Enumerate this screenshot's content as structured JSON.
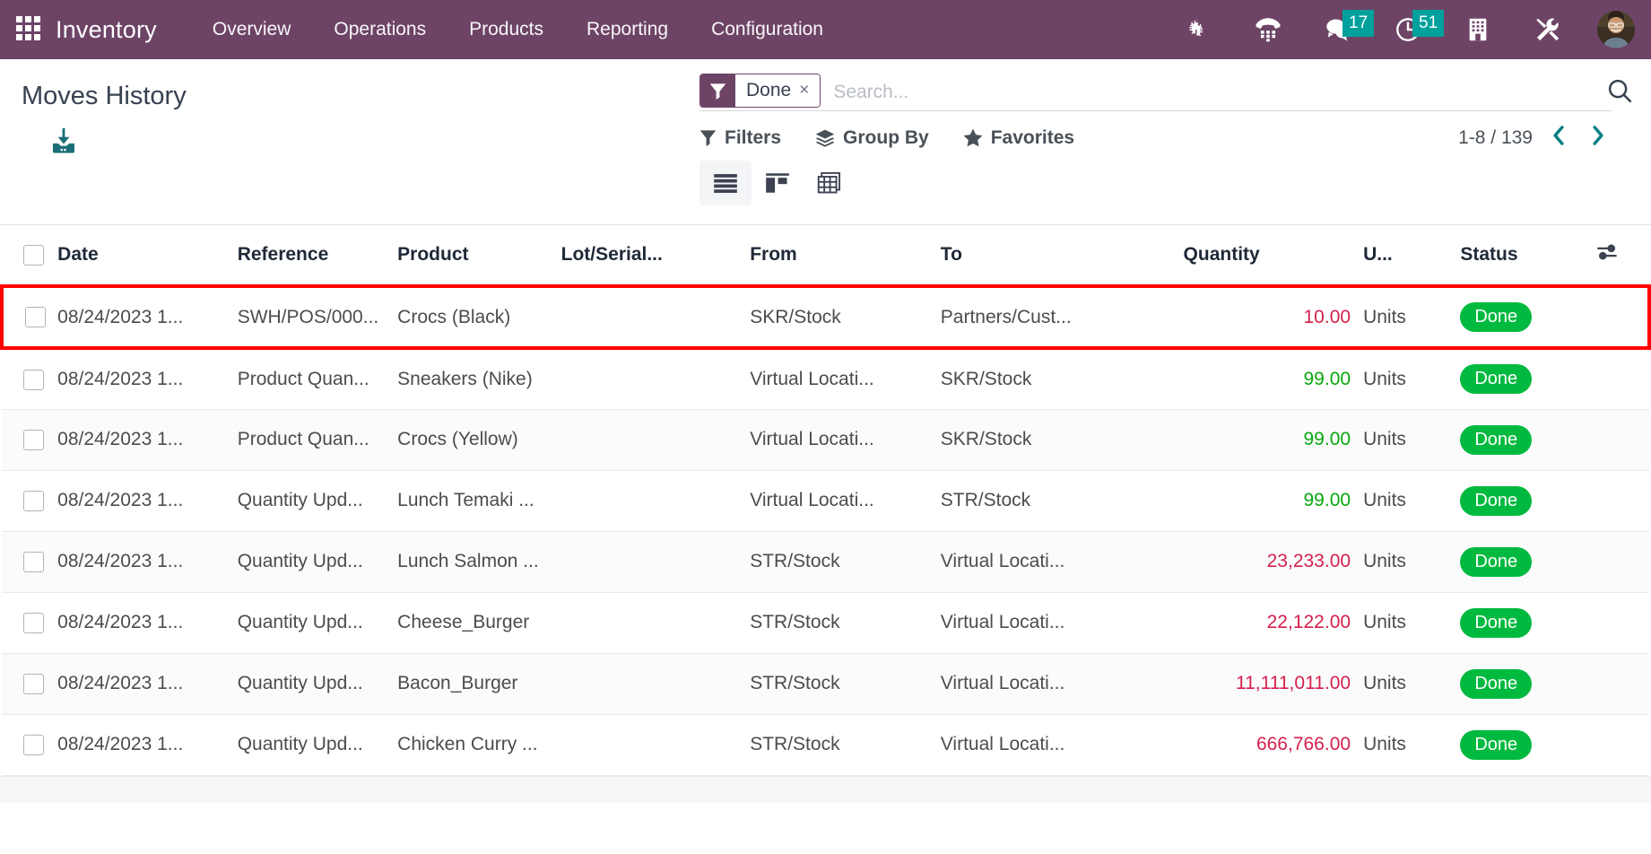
{
  "navbar": {
    "apps_icon": "apps-grid-icon",
    "brand": "Inventory",
    "menu": [
      {
        "label": "Overview"
      },
      {
        "label": "Operations"
      },
      {
        "label": "Products"
      },
      {
        "label": "Reporting"
      },
      {
        "label": "Configuration"
      }
    ],
    "sys_icons": [
      {
        "name": "bug-icon",
        "badge": null
      },
      {
        "name": "voip-dialpad-icon",
        "badge": null
      },
      {
        "name": "messages-icon",
        "badge": "17"
      },
      {
        "name": "activities-clock-icon",
        "badge": "51"
      },
      {
        "name": "company-building-icon",
        "badge": null
      },
      {
        "name": "debug-tools-icon",
        "badge": null
      }
    ],
    "avatar": "user-avatar",
    "badge_color": "#00a09d",
    "bg_color": "#6d4466"
  },
  "control_panel": {
    "title": "Moves History",
    "import_icon": "import-download-icon",
    "search": {
      "facet": {
        "icon": "filter-funnel-icon",
        "label": "Done",
        "remove": "×"
      },
      "placeholder": "Search...",
      "value": "",
      "magnifier_icon": "search-icon"
    },
    "buttons": [
      {
        "icon": "filter-funnel-icon",
        "label": "Filters",
        "name": "filters-dropdown"
      },
      {
        "icon": "group-by-layers-icon",
        "label": "Group By",
        "name": "group-by-dropdown"
      },
      {
        "icon": "star-icon",
        "label": "Favorites",
        "name": "favorites-dropdown"
      }
    ],
    "pager": {
      "count": "1-8 / 139",
      "prev": "‹",
      "next": "›"
    },
    "views": [
      {
        "name": "list-view-button",
        "icon": "list-icon",
        "active": true
      },
      {
        "name": "kanban-view-button",
        "icon": "kanban-icon",
        "active": false
      },
      {
        "name": "pivot-view-button",
        "icon": "pivot-grid-icon",
        "active": false
      }
    ]
  },
  "table": {
    "columns": [
      {
        "key": "date",
        "label": "Date"
      },
      {
        "key": "reference",
        "label": "Reference"
      },
      {
        "key": "product",
        "label": "Product"
      },
      {
        "key": "lot",
        "label": "Lot/Serial..."
      },
      {
        "key": "from",
        "label": "From"
      },
      {
        "key": "to",
        "label": "To"
      },
      {
        "key": "quantity",
        "label": "Quantity"
      },
      {
        "key": "uom",
        "label": "U..."
      },
      {
        "key": "status",
        "label": "Status"
      }
    ],
    "optional_columns_icon": "column-options-icon",
    "rows": [
      {
        "date": "08/24/2023 1...",
        "reference": "SWH/POS/000...",
        "product": "Crocs (Black)",
        "lot": "",
        "from": "SKR/Stock",
        "to": "Partners/Cust...",
        "quantity": "10.00",
        "quantity_sign": "neg",
        "uom": "Units",
        "status": "Done",
        "highlighted": true
      },
      {
        "date": "08/24/2023 1...",
        "reference": "Product Quan...",
        "product": "Sneakers (Nike)",
        "lot": "",
        "from": "Virtual Locati...",
        "to": "SKR/Stock",
        "quantity": "99.00",
        "quantity_sign": "pos",
        "uom": "Units",
        "status": "Done",
        "highlighted": false
      },
      {
        "date": "08/24/2023 1...",
        "reference": "Product Quan...",
        "product": "Crocs (Yellow)",
        "lot": "",
        "from": "Virtual Locati...",
        "to": "SKR/Stock",
        "quantity": "99.00",
        "quantity_sign": "pos",
        "uom": "Units",
        "status": "Done",
        "highlighted": false
      },
      {
        "date": "08/24/2023 1...",
        "reference": "Quantity Upd...",
        "product": "Lunch Temaki ...",
        "lot": "",
        "from": "Virtual Locati...",
        "to": "STR/Stock",
        "quantity": "99.00",
        "quantity_sign": "pos",
        "uom": "Units",
        "status": "Done",
        "highlighted": false
      },
      {
        "date": "08/24/2023 1...",
        "reference": "Quantity Upd...",
        "product": "Lunch Salmon ...",
        "lot": "",
        "from": "STR/Stock",
        "to": "Virtual Locati...",
        "quantity": "23,233.00",
        "quantity_sign": "neg",
        "uom": "Units",
        "status": "Done",
        "highlighted": false
      },
      {
        "date": "08/24/2023 1...",
        "reference": "Quantity Upd...",
        "product": "Cheese_Burger",
        "lot": "",
        "from": "STR/Stock",
        "to": "Virtual Locati...",
        "quantity": "22,122.00",
        "quantity_sign": "neg",
        "uom": "Units",
        "status": "Done",
        "highlighted": false
      },
      {
        "date": "08/24/2023 1...",
        "reference": "Quantity Upd...",
        "product": "Bacon_Burger",
        "lot": "",
        "from": "STR/Stock",
        "to": "Virtual Locati...",
        "quantity": "11,111,011.00",
        "quantity_sign": "neg",
        "uom": "Units",
        "status": "Done",
        "highlighted": false
      },
      {
        "date": "08/24/2023 1...",
        "reference": "Quantity Upd...",
        "product": "Chicken Curry ...",
        "lot": "",
        "from": "STR/Stock",
        "to": "Virtual Locati...",
        "quantity": "666,766.00",
        "quantity_sign": "neg",
        "uom": "Units",
        "status": "Done",
        "highlighted": false
      }
    ]
  },
  "colors": {
    "brand_purple": "#6d4466",
    "badge_teal": "#00a09d",
    "status_green": "#00b93f",
    "qty_positive": "#08a80d",
    "qty_negative": "#d4204c",
    "highlight_red": "#ff0000",
    "pager_teal": "#017e84"
  }
}
